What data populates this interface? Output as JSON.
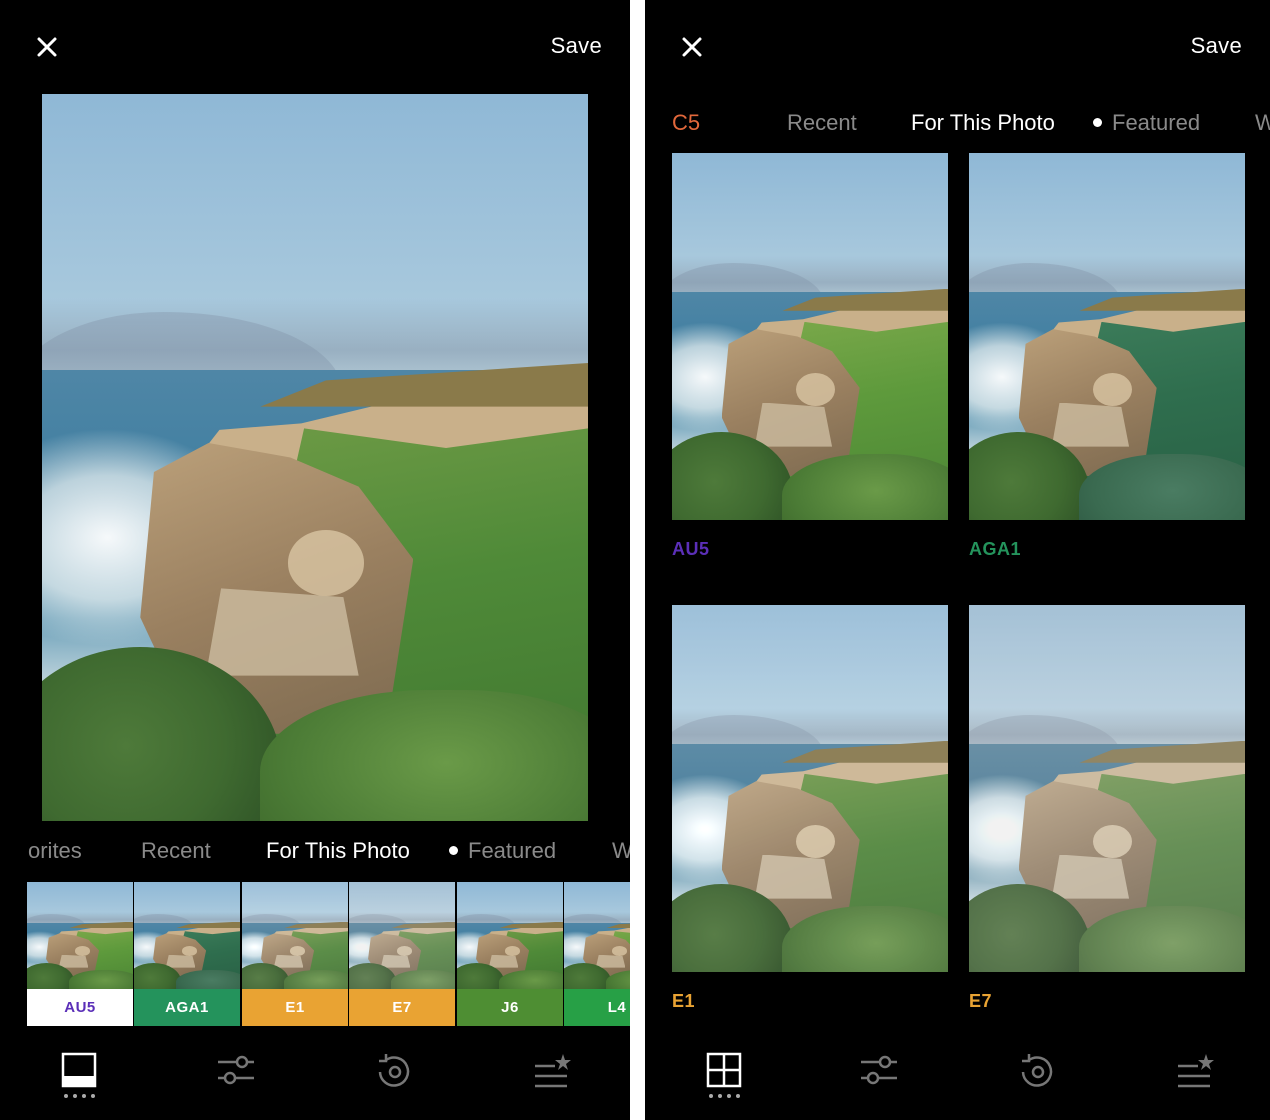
{
  "colors": {
    "au5": "#5b2fb8",
    "aga1": "#24935c",
    "e1": "#e9a333",
    "e7": "#e9a333",
    "j6": "#4e8e33",
    "l4": "#27a046",
    "c5": "#e2683b"
  },
  "left": {
    "close_icon": "close-icon",
    "save_label": "Save",
    "tabs": [
      "orites",
      "Recent",
      "For This Photo",
      "Featured",
      "W"
    ],
    "active_tab": "For This Photo",
    "presets": [
      {
        "label": "AU5",
        "selected": true
      },
      {
        "label": "AGA1"
      },
      {
        "label": "E1"
      },
      {
        "label": "E7"
      },
      {
        "label": "J6"
      },
      {
        "label": "L4"
      }
    ],
    "nav_icons": [
      "image-icon",
      "sliders-icon",
      "history-icon",
      "recipes-icon"
    ]
  },
  "right": {
    "close_icon": "close-icon",
    "save_label": "Save",
    "tabs": [
      "C5",
      "Recent",
      "For This Photo",
      "Featured",
      "W"
    ],
    "active_tab": "For This Photo",
    "grid": [
      {
        "label": "AU5"
      },
      {
        "label": "AGA1"
      },
      {
        "label": "E1"
      },
      {
        "label": "E7"
      }
    ],
    "nav_icons": [
      "grid-icon",
      "sliders-icon",
      "history-icon",
      "recipes-icon"
    ]
  }
}
